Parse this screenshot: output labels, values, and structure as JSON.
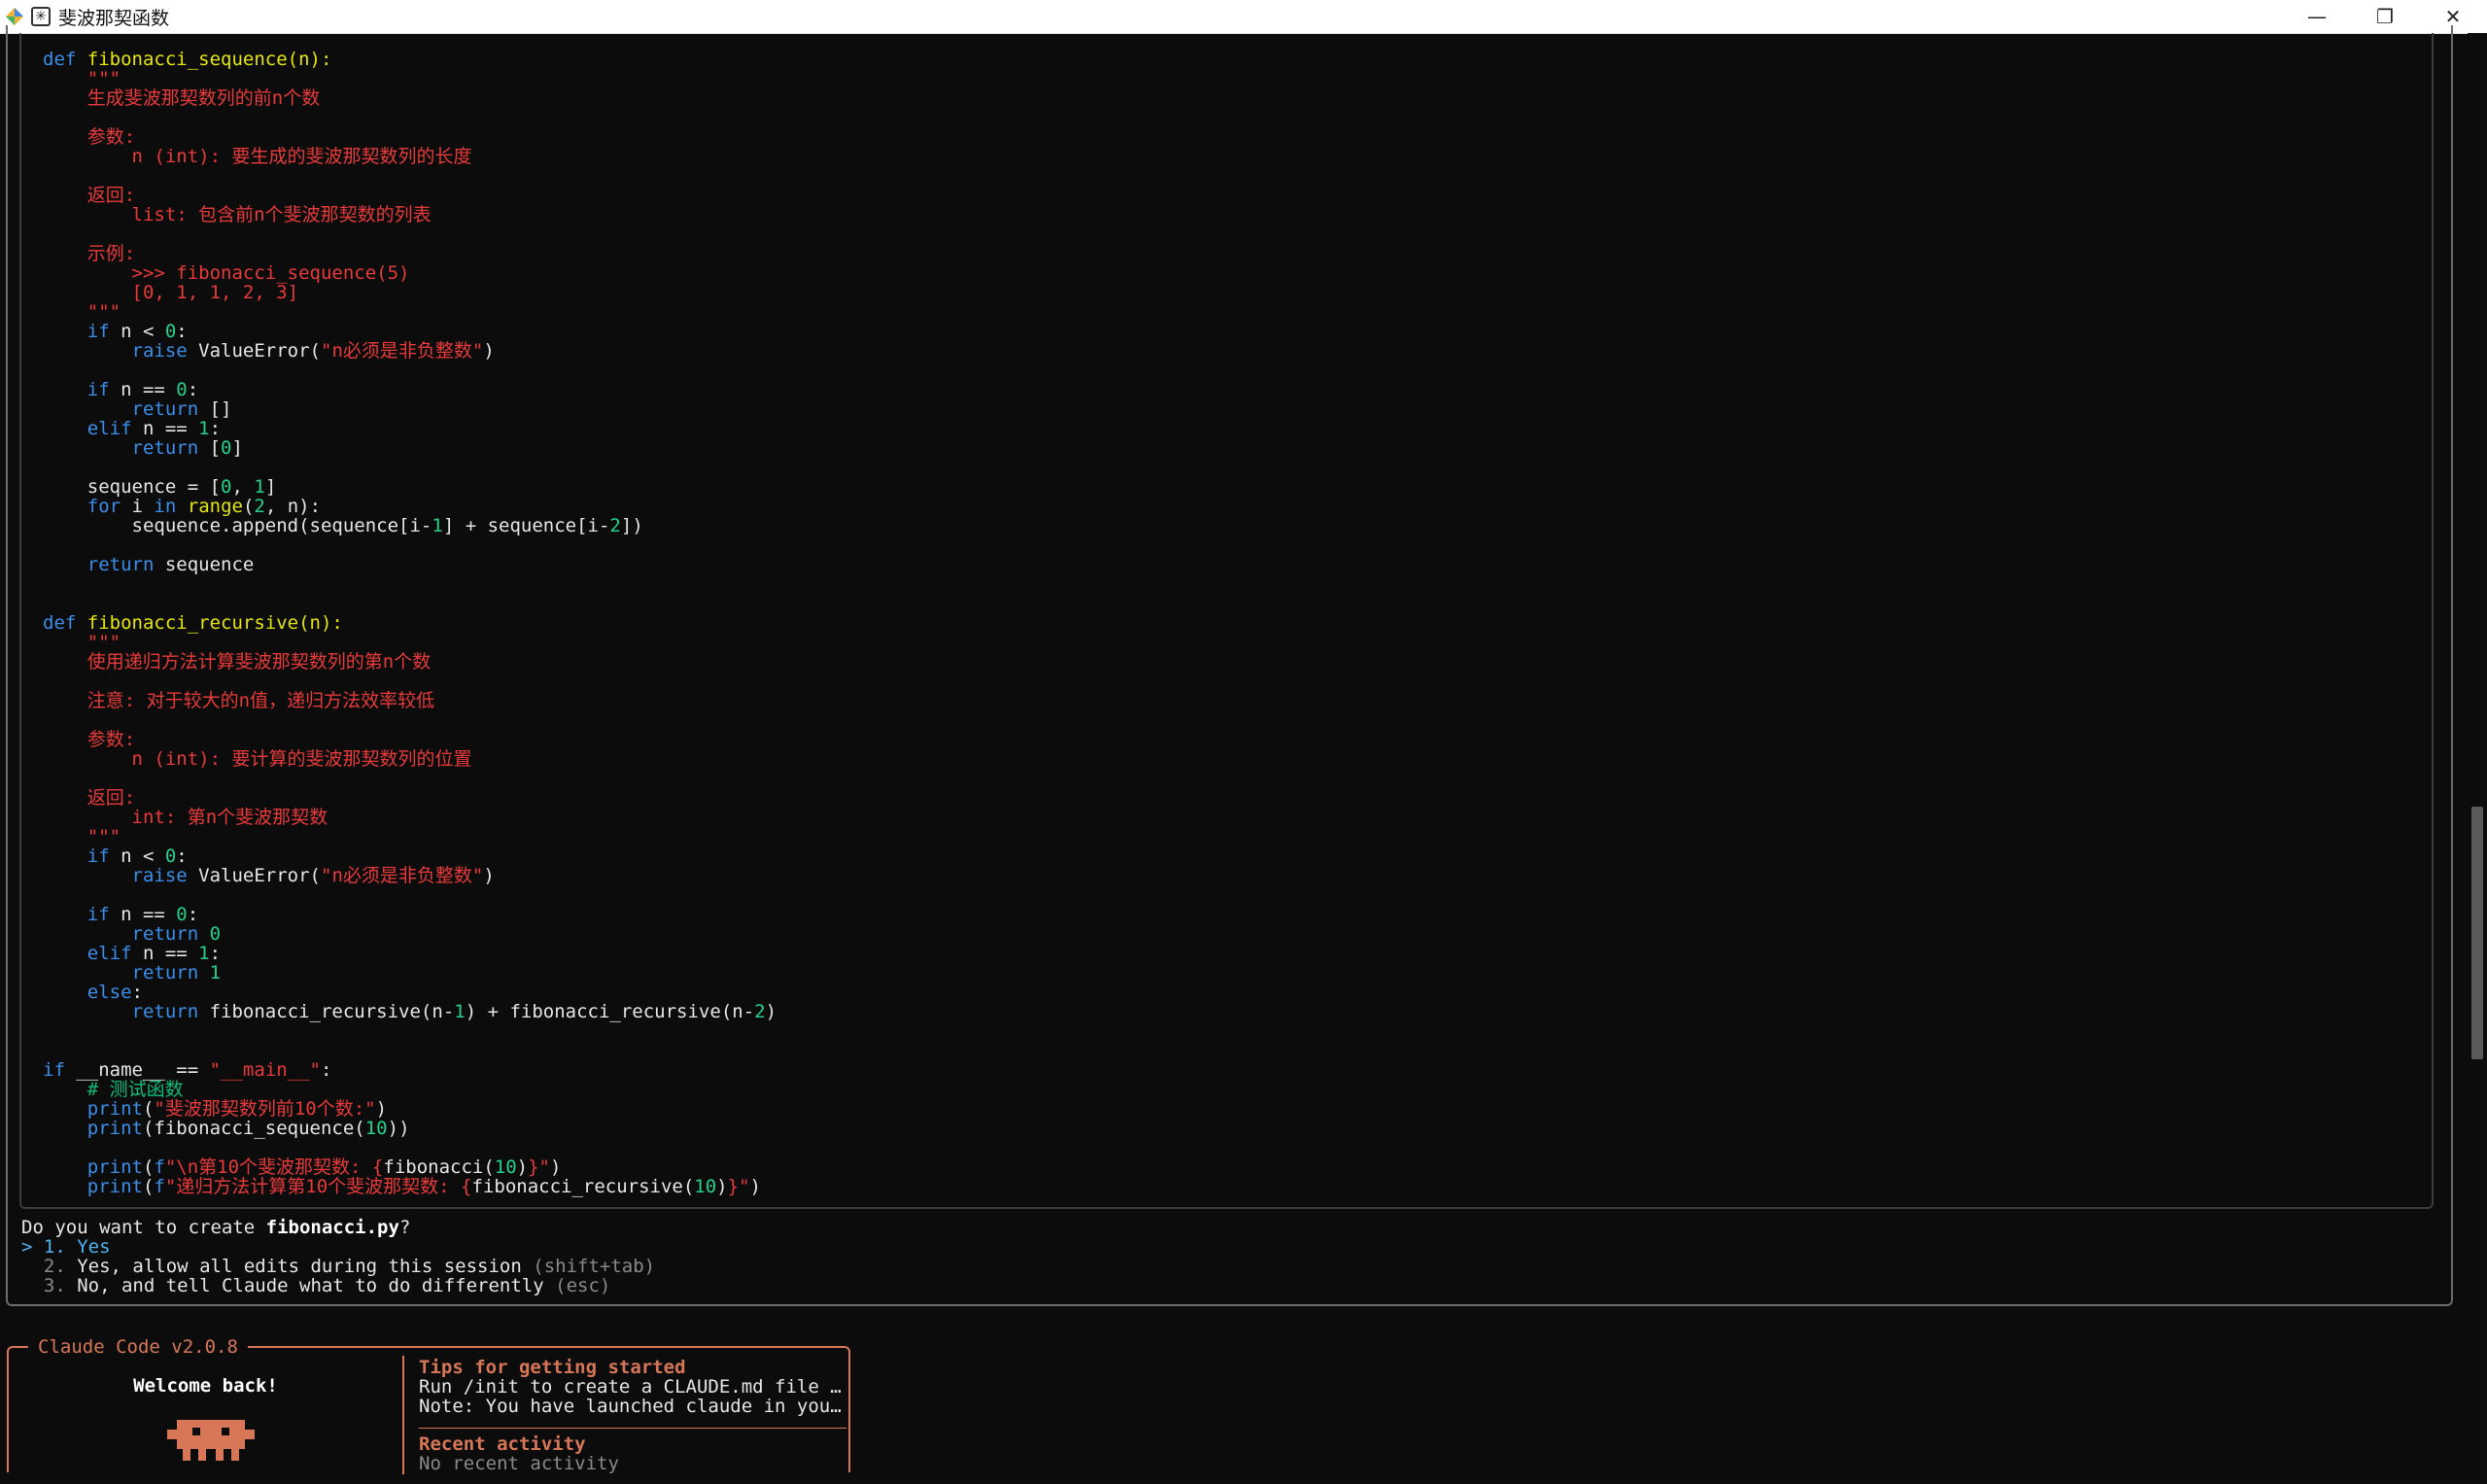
{
  "window": {
    "title": "斐波那契函数",
    "minimize_glyph": "—",
    "maximize_glyph": "❐",
    "close_glyph": "✕",
    "app_icon": "app-logo-icon",
    "terminal_icon": "terminal-icon"
  },
  "colors": {
    "keyword": "#3b8eea",
    "function": "#e5e510",
    "string": "#e83a3a",
    "number": "#23d18b",
    "accent": "#d77757"
  },
  "code": {
    "lines": [
      [
        [
          "kw",
          "def "
        ],
        [
          "fn",
          "fibonacci_sequence(n):"
        ]
      ],
      [
        [
          "st",
          "    \"\"\""
        ]
      ],
      [
        [
          "st",
          "    生成斐波那契数列的前n个数"
        ]
      ],
      [
        [
          "st",
          ""
        ]
      ],
      [
        [
          "st",
          "    参数:"
        ]
      ],
      [
        [
          "st",
          "        n (int): 要生成的斐波那契数列的长度"
        ]
      ],
      [
        [
          "st",
          ""
        ]
      ],
      [
        [
          "st",
          "    返回:"
        ]
      ],
      [
        [
          "st",
          "        list: 包含前n个斐波那契数的列表"
        ]
      ],
      [
        [
          "st",
          ""
        ]
      ],
      [
        [
          "st",
          "    示例:"
        ]
      ],
      [
        [
          "st",
          "        >>> fibonacci_sequence(5)"
        ]
      ],
      [
        [
          "st",
          "        [0, 1, 1, 2, 3]"
        ]
      ],
      [
        [
          "st",
          "    \"\"\""
        ]
      ],
      [
        [
          "kw",
          "    if"
        ],
        [
          "tx",
          " n < "
        ],
        [
          "nm",
          "0"
        ],
        [
          "tx",
          ":"
        ]
      ],
      [
        [
          "kw",
          "        raise"
        ],
        [
          "tx",
          " ValueError("
        ],
        [
          "st",
          "\"n必须是非负整数\""
        ],
        [
          "tx",
          ")"
        ]
      ],
      [
        [
          "tx",
          ""
        ]
      ],
      [
        [
          "kw",
          "    if"
        ],
        [
          "tx",
          " n == "
        ],
        [
          "nm",
          "0"
        ],
        [
          "tx",
          ":"
        ]
      ],
      [
        [
          "kw",
          "        return"
        ],
        [
          "tx",
          " []"
        ]
      ],
      [
        [
          "kw",
          "    elif"
        ],
        [
          "tx",
          " n == "
        ],
        [
          "nm",
          "1"
        ],
        [
          "tx",
          ":"
        ]
      ],
      [
        [
          "kw",
          "        return"
        ],
        [
          "tx",
          " ["
        ],
        [
          "nm",
          "0"
        ],
        [
          "tx",
          "]"
        ]
      ],
      [
        [
          "tx",
          ""
        ]
      ],
      [
        [
          "tx",
          "    sequence = ["
        ],
        [
          "nm",
          "0"
        ],
        [
          "tx",
          ", "
        ],
        [
          "nm",
          "1"
        ],
        [
          "tx",
          "]"
        ]
      ],
      [
        [
          "kw",
          "    for"
        ],
        [
          "tx",
          " i "
        ],
        [
          "kw",
          "in"
        ],
        [
          "tx",
          " "
        ],
        [
          "fn",
          "range"
        ],
        [
          "tx",
          "("
        ],
        [
          "nm",
          "2"
        ],
        [
          "tx",
          ", n):"
        ]
      ],
      [
        [
          "tx",
          "        sequence.append(sequence[i-"
        ],
        [
          "nm",
          "1"
        ],
        [
          "tx",
          "] + sequence[i-"
        ],
        [
          "nm",
          "2"
        ],
        [
          "tx",
          "])"
        ]
      ],
      [
        [
          "tx",
          ""
        ]
      ],
      [
        [
          "kw",
          "    return"
        ],
        [
          "tx",
          " sequence"
        ]
      ],
      [
        [
          "tx",
          ""
        ]
      ],
      [
        [
          "tx",
          ""
        ]
      ],
      [
        [
          "kw",
          "def "
        ],
        [
          "fn",
          "fibonacci_recursive(n):"
        ]
      ],
      [
        [
          "st",
          "    \"\"\""
        ]
      ],
      [
        [
          "st",
          "    使用递归方法计算斐波那契数列的第n个数"
        ]
      ],
      [
        [
          "st",
          ""
        ]
      ],
      [
        [
          "st",
          "    注意: 对于较大的n值，递归方法效率较低"
        ]
      ],
      [
        [
          "st",
          ""
        ]
      ],
      [
        [
          "st",
          "    参数:"
        ]
      ],
      [
        [
          "st",
          "        n (int): 要计算的斐波那契数列的位置"
        ]
      ],
      [
        [
          "st",
          ""
        ]
      ],
      [
        [
          "st",
          "    返回:"
        ]
      ],
      [
        [
          "st",
          "        int: 第n个斐波那契数"
        ]
      ],
      [
        [
          "st",
          "    \"\"\""
        ]
      ],
      [
        [
          "kw",
          "    if"
        ],
        [
          "tx",
          " n < "
        ],
        [
          "nm",
          "0"
        ],
        [
          "tx",
          ":"
        ]
      ],
      [
        [
          "kw",
          "        raise"
        ],
        [
          "tx",
          " ValueError("
        ],
        [
          "st",
          "\"n必须是非负整数\""
        ],
        [
          "tx",
          ")"
        ]
      ],
      [
        [
          "tx",
          ""
        ]
      ],
      [
        [
          "kw",
          "    if"
        ],
        [
          "tx",
          " n == "
        ],
        [
          "nm",
          "0"
        ],
        [
          "tx",
          ":"
        ]
      ],
      [
        [
          "kw",
          "        return"
        ],
        [
          "tx",
          " "
        ],
        [
          "nm",
          "0"
        ]
      ],
      [
        [
          "kw",
          "    elif"
        ],
        [
          "tx",
          " n == "
        ],
        [
          "nm",
          "1"
        ],
        [
          "tx",
          ":"
        ]
      ],
      [
        [
          "kw",
          "        return"
        ],
        [
          "tx",
          " "
        ],
        [
          "nm",
          "1"
        ]
      ],
      [
        [
          "kw",
          "    else"
        ],
        [
          "tx",
          ":"
        ]
      ],
      [
        [
          "kw",
          "        return"
        ],
        [
          "tx",
          " fibonacci_recursive(n-"
        ],
        [
          "nm",
          "1"
        ],
        [
          "tx",
          ") + fibonacci_recursive(n-"
        ],
        [
          "nm",
          "2"
        ],
        [
          "tx",
          ")"
        ]
      ],
      [
        [
          "tx",
          ""
        ]
      ],
      [
        [
          "tx",
          ""
        ]
      ],
      [
        [
          "kw",
          "if"
        ],
        [
          "tx",
          " __name__ == "
        ],
        [
          "st",
          "\"__main__\""
        ],
        [
          "tx",
          ":"
        ]
      ],
      [
        [
          "cm",
          "    # 测试函数"
        ]
      ],
      [
        [
          "kw",
          "    print"
        ],
        [
          "tx",
          "("
        ],
        [
          "st",
          "\"斐波那契数列前10个数:\""
        ],
        [
          "tx",
          ")"
        ]
      ],
      [
        [
          "kw",
          "    print"
        ],
        [
          "tx",
          "(fibonacci_sequence("
        ],
        [
          "nm",
          "10"
        ],
        [
          "tx",
          "))"
        ]
      ],
      [
        [
          "tx",
          ""
        ]
      ],
      [
        [
          "kw",
          "    print"
        ],
        [
          "tx",
          "("
        ],
        [
          "kw",
          "f"
        ],
        [
          "st",
          "\"\\n第10个斐波那契数: {"
        ],
        [
          "tx",
          "fibonacci("
        ],
        [
          "nm",
          "10"
        ],
        [
          "tx",
          ")"
        ],
        [
          "st",
          "}\""
        ],
        [
          "tx",
          ")"
        ]
      ],
      [
        [
          "kw",
          "    print"
        ],
        [
          "tx",
          "("
        ],
        [
          "kw",
          "f"
        ],
        [
          "st",
          "\"递归方法计算第10个斐波那契数: {"
        ],
        [
          "tx",
          "fibonacci_recursive("
        ],
        [
          "nm",
          "10"
        ],
        [
          "tx",
          ")"
        ],
        [
          "st",
          "}\""
        ],
        [
          "tx",
          ")"
        ]
      ]
    ]
  },
  "prompt": {
    "question_prefix": "Do you want to create ",
    "filename": "fibonacci.py",
    "question_suffix": "?",
    "cursor": "> ",
    "options": [
      {
        "num": "1.",
        "label": "Yes",
        "hint": ""
      },
      {
        "num": "2.",
        "label": "Yes, allow all edits during this session",
        "hint": "(shift+tab)"
      },
      {
        "num": "3.",
        "label": "No, and tell Claude what to do differently",
        "hint": "(esc)"
      }
    ]
  },
  "welcome": {
    "title": "Claude Code v2.0.8",
    "greeting": "Welcome back!",
    "mascot_icon": "claude-mascot-icon",
    "tips_heading": "Tips for getting started",
    "tips": [
      "Run /init to create a CLAUDE.md file w…",
      "Note: You have launched claude in your…"
    ],
    "activity_heading": "Recent activity",
    "activity_text": "No recent activity"
  }
}
